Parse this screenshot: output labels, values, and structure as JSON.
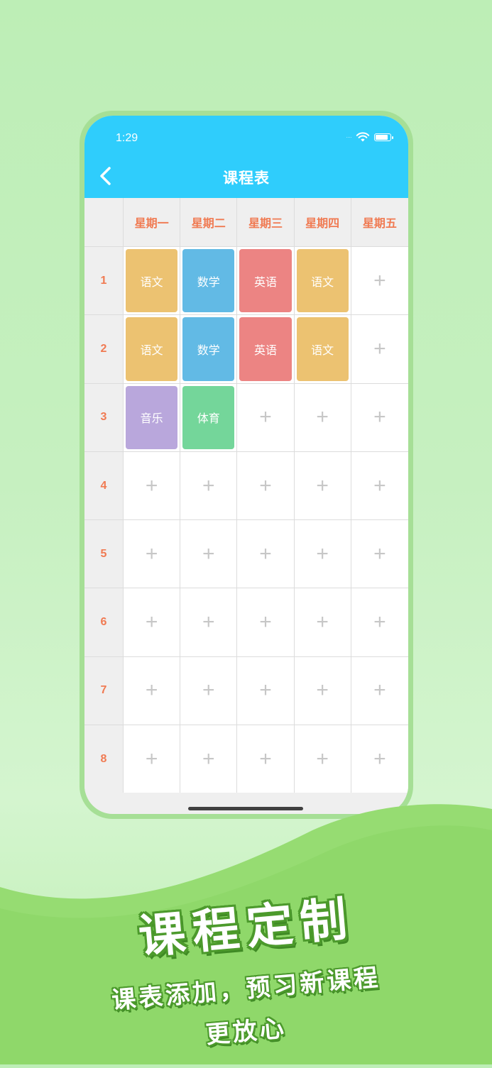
{
  "status_bar": {
    "time": "1:29",
    "signal": "····"
  },
  "nav": {
    "title": "课程表"
  },
  "days": [
    "星期一",
    "星期二",
    "星期三",
    "星期四",
    "星期五"
  ],
  "periods": [
    {
      "number": "1",
      "cells": [
        "语文",
        "数学",
        "英语",
        "语文",
        ""
      ]
    },
    {
      "number": "2",
      "cells": [
        "语文",
        "数学",
        "英语",
        "语文",
        ""
      ]
    },
    {
      "number": "3",
      "cells": [
        "音乐",
        "体育",
        "",
        "",
        ""
      ]
    },
    {
      "number": "4",
      "cells": [
        "",
        "",
        "",
        "",
        ""
      ]
    },
    {
      "number": "5",
      "cells": [
        "",
        "",
        "",
        "",
        ""
      ]
    },
    {
      "number": "6",
      "cells": [
        "",
        "",
        "",
        "",
        ""
      ]
    },
    {
      "number": "7",
      "cells": [
        "",
        "",
        "",
        "",
        ""
      ]
    },
    {
      "number": "8",
      "cells": [
        "",
        "",
        "",
        "",
        ""
      ]
    }
  ],
  "course_colors": {
    "语文": "#ecc271",
    "数学": "#62bae5",
    "英语": "#ec8483",
    "音乐": "#b9a7dc",
    "体育": "#74d69a"
  },
  "empty_cell_symbol": "+",
  "promo": {
    "headline": "课程定制",
    "subline1": "课表添加，预习新课程",
    "subline2": "更放心"
  },
  "colors": {
    "nav_bar": "#2fcdfc",
    "header_text": "#f07a52",
    "phone_frame": "#a6df96"
  }
}
